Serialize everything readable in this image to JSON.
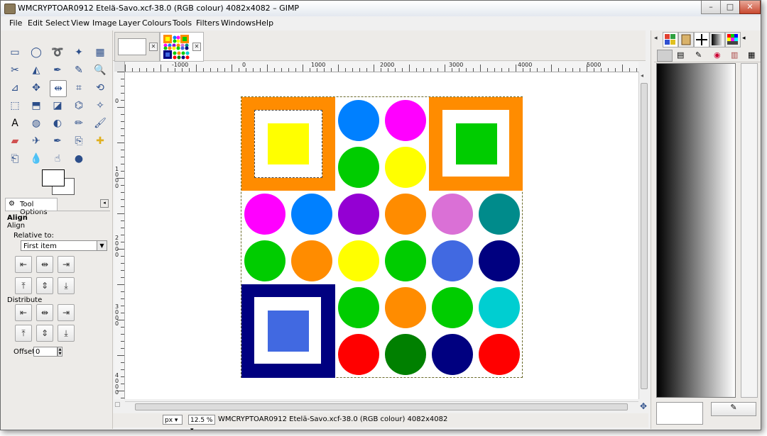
{
  "window": {
    "title": "WMCRYPTOAR0912 Etelä-Savo.xcf-38.0 (RGB colour) 4082x4082 – GIMP",
    "minimize_glyph": "–",
    "maximize_glyph": "□",
    "close_glyph": "✕"
  },
  "menu": {
    "items": [
      "File",
      "Edit",
      "Select",
      "View",
      "Image",
      "Layer",
      "Colours",
      "Tools",
      "Filters",
      "Windows",
      "Help"
    ]
  },
  "toolbox": {
    "tools": [
      "rect-select",
      "ellipse-select",
      "free-select",
      "fuzzy-select",
      "select-by-color",
      "scissors-select",
      "foreground-select",
      "paths",
      "color-picker",
      "zoom",
      "measure",
      "move",
      "align",
      "crop",
      "transform",
      "unified-transform",
      "perspective",
      "flip",
      "cage-transform",
      "warp",
      "text",
      "bucket-fill",
      "blend",
      "pencil",
      "paintbrush",
      "eraser",
      "airbrush",
      "ink",
      "clone",
      "heal",
      "perspective-clone",
      "blur-sharpen",
      "smudge",
      "dodge-burn"
    ],
    "active_tool": "align",
    "foreground_color": "#ffffff",
    "background_color": "#ffffff"
  },
  "tool_options": {
    "tab_label": "Tool Options",
    "title": "Align",
    "subtitle": "Align",
    "relative_to_label": "Relative to:",
    "relative_to_value": "First item",
    "distribute_label": "Distribute",
    "offset_label": "Offset:",
    "offset_value": "0"
  },
  "ruler": {
    "h_labels": [
      "-1000",
      "0",
      "1000",
      "2000",
      "3000",
      "4000",
      "5000"
    ],
    "v_labels": [
      "0",
      "1000",
      "2000",
      "3000",
      "4000"
    ]
  },
  "image_content": {
    "background": "#ffffff",
    "squares": [
      {
        "name": "orange-frame-yellow",
        "outer": "#ff8c00",
        "inner": "#ffff00"
      },
      {
        "name": "orange-frame-green",
        "outer": "#ff8c00",
        "inner": "#00cc00"
      },
      {
        "name": "navy-frame-blue",
        "outer": "#000080",
        "inner": "#4169e1"
      }
    ],
    "circle_colors": [
      "#0080ff",
      "#ff00ff",
      "#00cc00",
      "#ffff00",
      "#ff00ff",
      "#0080ff",
      "#9400d3",
      "#ff8c00",
      "#da70d6",
      "#008b8b",
      "#00cc00",
      "#ff8c00",
      "#ffff00",
      "#00cc00",
      "#4169e1",
      "#000080",
      "#00cc00",
      "#ff8c00",
      "#00cc00",
      "#00ced1",
      "#ff0000",
      "#008000",
      "#000080",
      "#ff0000"
    ]
  },
  "statusbar": {
    "unit": "px",
    "zoom": "12.5 %",
    "text": "WMCRYPTOAR0912 Etelä-Savo.xcf-38.0 (RGB colour) 4082x4082"
  },
  "dock": {
    "gradient_start": "#000000",
    "gradient_end": "#ffffff"
  }
}
